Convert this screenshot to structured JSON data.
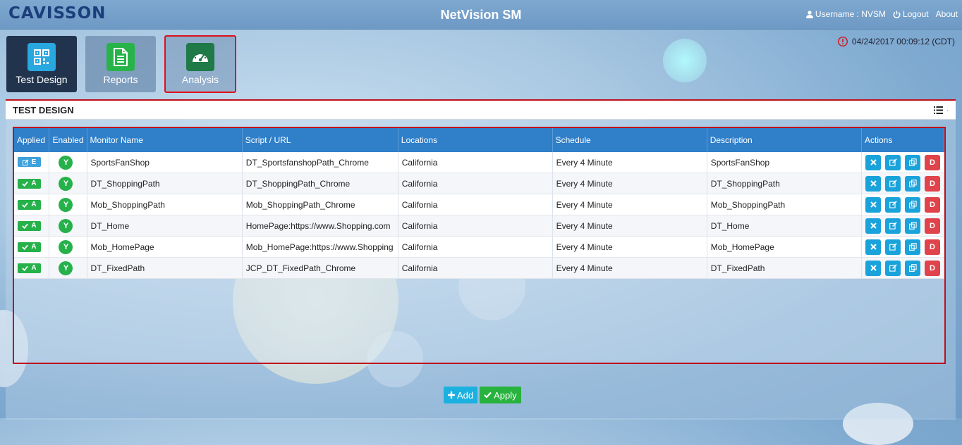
{
  "header": {
    "logo_text": "CAVISSON",
    "app_title": "NetVision SM",
    "username_label": "Username : NVSM",
    "logout_label": "Logout",
    "about_label": "About"
  },
  "tiles": [
    {
      "label": "Test Design",
      "icon": "qr-code-icon",
      "color": "#29a7df"
    },
    {
      "label": "Reports",
      "icon": "document-icon",
      "color": "#27b34a"
    },
    {
      "label": "Analysis",
      "icon": "dashboard-gauge-icon",
      "color": "#1f7a48"
    }
  ],
  "datetime": "04/24/2017 00:09:12 (CDT)",
  "panel": {
    "title": "TEST DESIGN",
    "columns": [
      "Applied",
      "Enabled",
      "Monitor Name",
      "Script / URL",
      "Locations",
      "Schedule",
      "Description",
      "Actions"
    ],
    "rows": [
      {
        "applied": "E",
        "enabled": "Y",
        "monitor": "SportsFanShop",
        "script": "DT_SportsfanshopPath_Chrome",
        "location": "California",
        "schedule": "Every 4 Minute",
        "description": "SportsFanShop"
      },
      {
        "applied": "A",
        "enabled": "Y",
        "monitor": "DT_ShoppingPath",
        "script": "DT_ShoppingPath_Chrome",
        "location": "California",
        "schedule": "Every 4 Minute",
        "description": "DT_ShoppingPath"
      },
      {
        "applied": "A",
        "enabled": "Y",
        "monitor": "Mob_ShoppingPath",
        "script": "Mob_ShoppingPath_Chrome",
        "location": "California",
        "schedule": "Every 4 Minute",
        "description": "Mob_ShoppingPath"
      },
      {
        "applied": "A",
        "enabled": "Y",
        "monitor": "DT_Home",
        "script": "HomePage:https://www.Shopping.com",
        "location": "California",
        "schedule": "Every 4 Minute",
        "description": "DT_Home"
      },
      {
        "applied": "A",
        "enabled": "Y",
        "monitor": "Mob_HomePage",
        "script": "Mob_HomePage:https://www.Shopping",
        "location": "California",
        "schedule": "Every 4 Minute",
        "description": "Mob_HomePage"
      },
      {
        "applied": "A",
        "enabled": "Y",
        "monitor": "DT_FixedPath",
        "script": "JCP_DT_FixedPath_Chrome",
        "location": "California",
        "schedule": "Every 4 Minute",
        "description": "DT_FixedPath"
      }
    ],
    "actions": {
      "delete_label": "D"
    }
  },
  "footer": {
    "add_label": "Add",
    "apply_label": "Apply"
  }
}
